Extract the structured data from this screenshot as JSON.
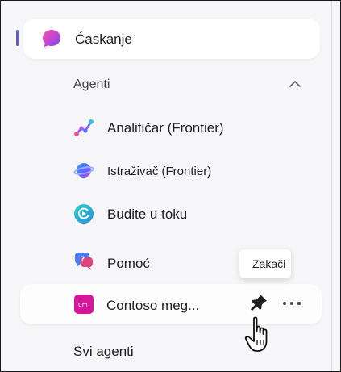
{
  "nav": {
    "chat_label": "Ćaskanje"
  },
  "agents_section": {
    "header": "Agenti",
    "items": [
      {
        "label": "Analitičar (Frontier)",
        "icon": "analyst-icon"
      },
      {
        "label": "Istraživač (Frontier)",
        "icon": "researcher-icon"
      },
      {
        "label": "Budite u toku",
        "icon": "stay-informed-icon"
      },
      {
        "label": "Pomoć",
        "icon": "help-icon"
      },
      {
        "label": "Contoso meg...",
        "icon": "contoso-icon",
        "icon_text": "Cm"
      }
    ],
    "all_agents_label": "Svi agenti"
  },
  "tooltip": {
    "pin_text": "Zakači"
  },
  "colors": {
    "accent": "#5b5fc7",
    "contoso": "#d4179b"
  }
}
